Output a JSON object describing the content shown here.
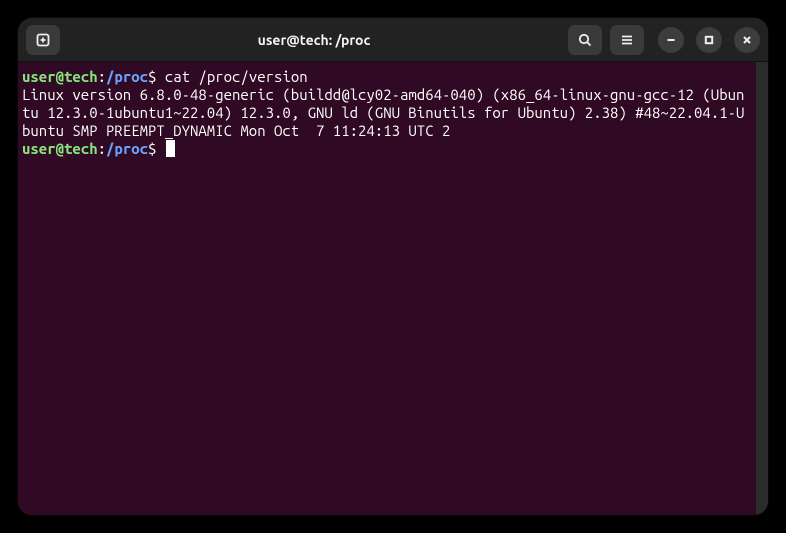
{
  "window": {
    "title": "user@tech: /proc"
  },
  "prompt": {
    "user_host": "user@tech",
    "colon": ":",
    "path": "/proc",
    "symbol": "$"
  },
  "lines": {
    "cmd1": " cat /proc/version",
    "output": "Linux version 6.8.0-48-generic (buildd@lcy02-amd64-040) (x86_64-linux-gnu-gcc-12 (Ubuntu 12.3.0-1ubuntu1~22.04) 12.3.0, GNU ld (GNU Binutils for Ubuntu) 2.38) #48~22.04.1-Ubuntu SMP PREEMPT_DYNAMIC Mon Oct  7 11:24:13 UTC 2",
    "cmd2": " "
  },
  "icons": {
    "new_tab": "new-tab-icon",
    "search": "search-icon",
    "menu": "hamburger-icon",
    "minimize": "minimize-icon",
    "maximize": "maximize-icon",
    "close": "close-icon"
  }
}
